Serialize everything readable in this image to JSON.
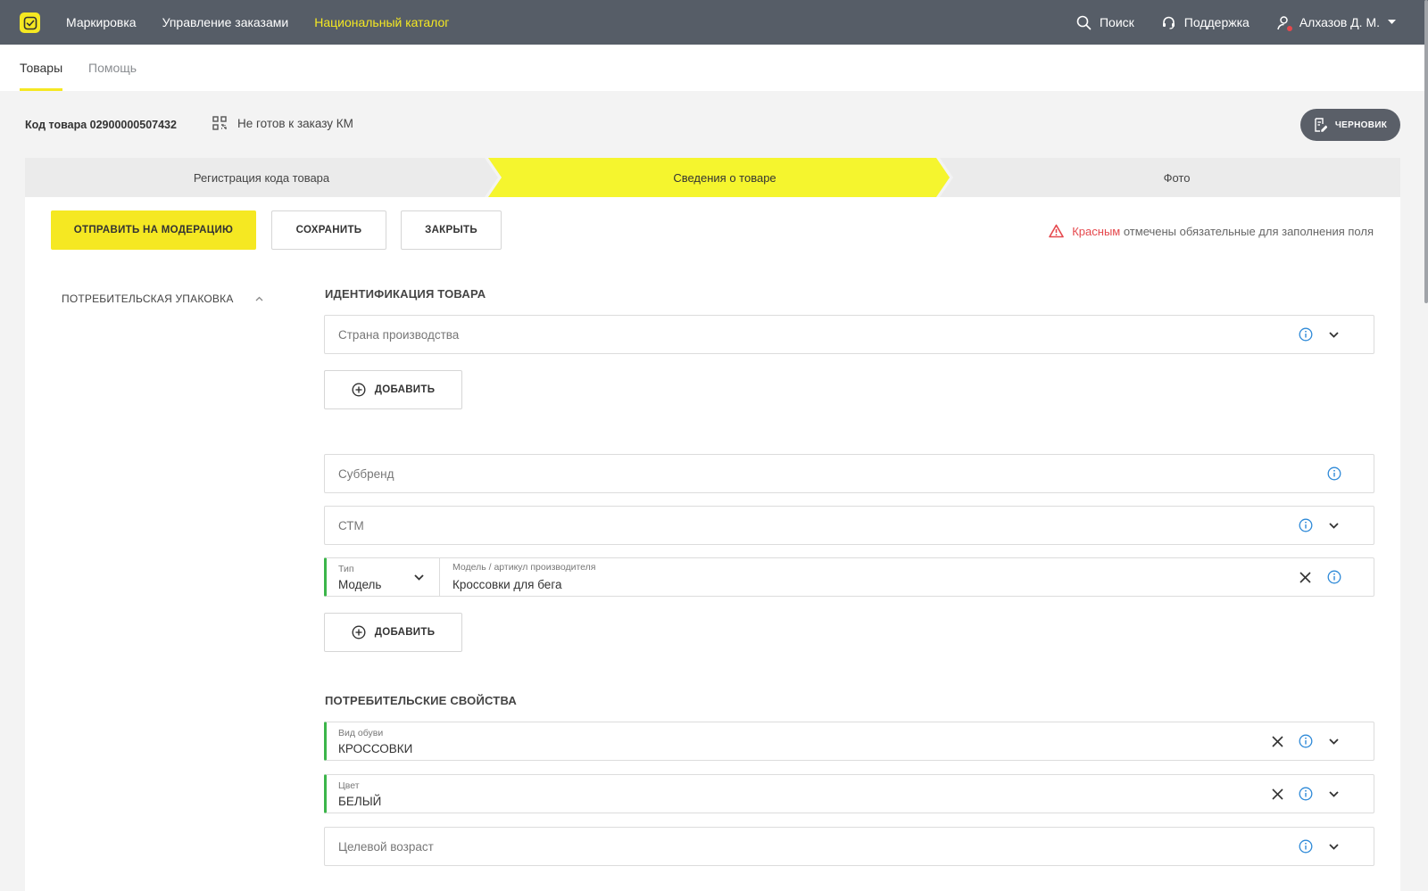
{
  "topbar": {
    "nav": [
      "Маркировка",
      "Управление заказами",
      "Национальный каталог"
    ],
    "search": "Поиск",
    "support": "Поддержка",
    "user": "Алхазов Д. М."
  },
  "subtabs": [
    "Товары",
    "Помощь"
  ],
  "product": {
    "code": "Код товара 02900000507432",
    "status": "Не готов к заказу КМ",
    "draft": "ЧЕРНОВИК"
  },
  "stepper": [
    "Регистрация кода товара",
    "Сведения о товаре",
    "Фото"
  ],
  "actions": {
    "submit": "ОТПРАВИТЬ НА МОДЕРАЦИЮ",
    "save": "СОХРАНИТЬ",
    "close": "ЗАКРЫТЬ"
  },
  "required_note": {
    "red": "Красным",
    "rest": "отмечены обязательные для заполнения поля"
  },
  "sidebar": {
    "section": "ПОТРЕБИТЕЛЬСКАЯ УПАКОВКА"
  },
  "identification": {
    "title": "ИДЕНТИФИКАЦИЯ ТОВАРА",
    "country_placeholder": "Страна производства",
    "add": "ДОБАВИТЬ",
    "subbrand_placeholder": "Суббренд",
    "stm_placeholder": "СТМ",
    "type_label": "Тип",
    "type_value": "Модель",
    "model_label": "Модель / артикул производителя",
    "model_value": "Кроссовки для бега",
    "add2": "ДОБАВИТЬ"
  },
  "consumer": {
    "title": "ПОТРЕБИТЕЛЬСКИЕ СВОЙСТВА",
    "shoe_label": "Вид обуви",
    "shoe_value": "КРОССОВКИ",
    "color_label": "Цвет",
    "color_value": "БЕЛЫЙ",
    "age_placeholder": "Целевой возраст"
  },
  "colors": {
    "accent": "#f5e822",
    "topbar": "#565d67",
    "filled_marker": "#3bb54a",
    "required": "#e5484d",
    "info_icon": "#2f8ad8"
  }
}
